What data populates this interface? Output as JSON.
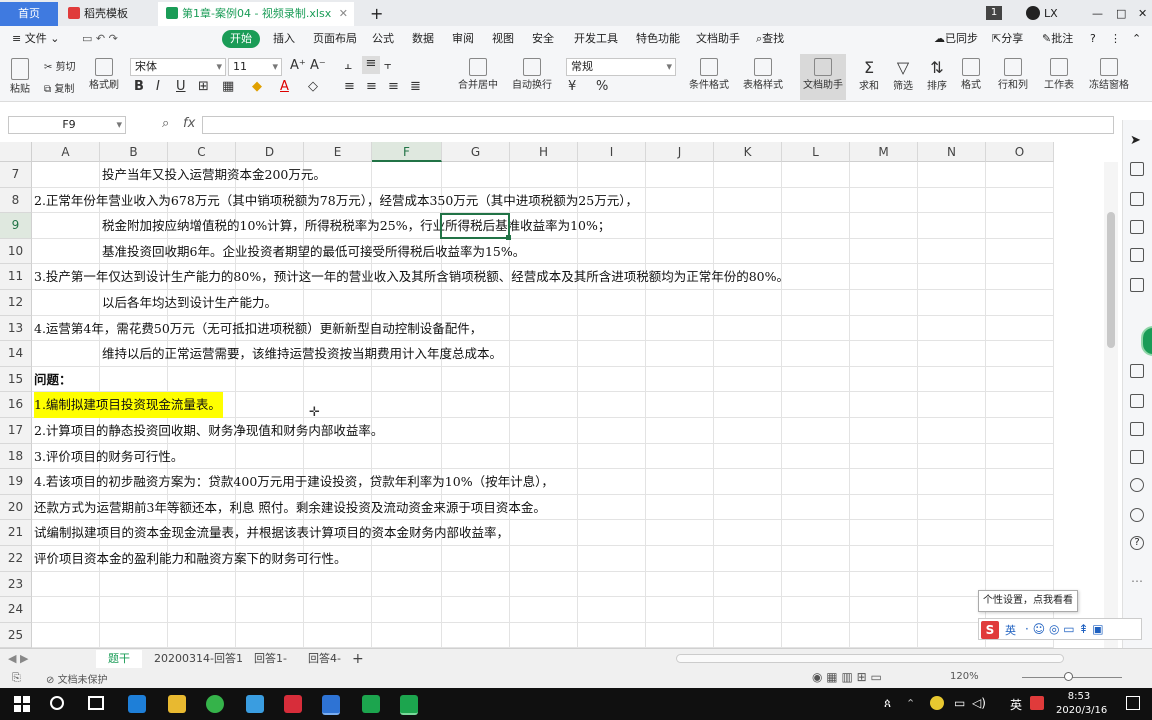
{
  "titlebar": {
    "tabs": [
      {
        "label": "首页",
        "active": false
      },
      {
        "label": "稻壳模板",
        "active": false
      },
      {
        "label": "第1章-案例04 - 视频录制.xlsx",
        "active": true
      }
    ],
    "new_tab": "+",
    "badge": "1",
    "user": "LX",
    "win_min": "—",
    "win_max": "□",
    "win_close": "✕"
  },
  "menubar": {
    "file": "文件",
    "start": "开始",
    "items": [
      "插入",
      "页面布局",
      "公式",
      "数据",
      "审阅",
      "视图",
      "安全",
      "开发工具",
      "特色功能",
      "文档助手"
    ],
    "find": "查找",
    "sync": "已同步",
    "share": "分享",
    "comment": "批注"
  },
  "ribbon": {
    "paste": "粘贴",
    "cut": "剪切",
    "copy": "复制",
    "format_painter": "格式刷",
    "font_name": "宋体",
    "font_size": "11",
    "bold": "B",
    "italic": "I",
    "underline": "U",
    "merge": "合并居中",
    "wrap": "自动换行",
    "number_format": "常规",
    "percent": "%",
    "conditional": "条件格式",
    "table_style": "表格样式",
    "doc_helper": "文档助手",
    "sum": "求和",
    "filter": "筛选",
    "sort": "排序",
    "format": "格式",
    "rowcol": "行和列",
    "worksheet": "工作表",
    "freeze": "冻结窗格"
  },
  "formula_bar": {
    "name_box": "F9",
    "fx": "fx",
    "content": ""
  },
  "columns": [
    "A",
    "B",
    "C",
    "D",
    "E",
    "F",
    "G",
    "H",
    "I",
    "J",
    "K",
    "L",
    "M",
    "N",
    "O"
  ],
  "rows": [
    {
      "num": "7",
      "col": "B",
      "text": "投产当年又投入运营期资本金200万元。"
    },
    {
      "num": "8",
      "col": "A",
      "text": "2.正常年份年营业收入为678万元（其中销项税额为78万元），经营成本350万元（其中进项税额为25万元），"
    },
    {
      "num": "9",
      "col": "B",
      "text": "税金附加按应纳增值税的10%计算，所得税税率为25%，行业所得税后基准收益率为10%；"
    },
    {
      "num": "10",
      "col": "B",
      "text": "基准投资回收期6年。企业投资者期望的最低可接受所得税后收益率为15%。"
    },
    {
      "num": "11",
      "col": "A",
      "text": "3.投产第一年仅达到设计生产能力的80%，预计这一年的营业收入及其所含销项税额、经营成本及其所含进项税额均为正常年份的80%。"
    },
    {
      "num": "12",
      "col": "B",
      "text": "以后各年均达到设计生产能力。"
    },
    {
      "num": "13",
      "col": "A",
      "text": "4.运营第4年，需花费50万元（无可抵扣进项税额）更新新型自动控制设备配件，"
    },
    {
      "num": "14",
      "col": "B",
      "text": "维持以后的正常运营需要，该维持运营投资按当期费用计入年度总成本。"
    },
    {
      "num": "15",
      "col": "A",
      "text": "问题：",
      "bold": true
    },
    {
      "num": "16",
      "col": "A",
      "text": "1.编制拟建项目投资现金流量表。",
      "highlight": "#ffff00"
    },
    {
      "num": "17",
      "col": "A",
      "text": "2.计算项目的静态投资回收期、财务净现值和财务内部收益率。"
    },
    {
      "num": "18",
      "col": "A",
      "text": "3.评价项目的财务可行性。"
    },
    {
      "num": "19",
      "col": "A",
      "text": "4.若该项目的初步融资方案为：贷款400万元用于建设投资，贷款年利率为10%（按年计息），"
    },
    {
      "num": "20",
      "col": "A",
      "text": "还款方式为运营期前3年等额还本，利息 照付。剩余建设投资及流动资金来源于项目资本金。"
    },
    {
      "num": "21",
      "col": "A",
      "text": "试编制拟建项目的资本金现金流量表，并根据该表计算项目的资本金财务内部收益率，"
    },
    {
      "num": "22",
      "col": "A",
      "text": "评价项目资本金的盈利能力和融资方案下的财务可行性。"
    },
    {
      "num": "23",
      "col": "A",
      "text": ""
    },
    {
      "num": "24",
      "col": "A",
      "text": ""
    },
    {
      "num": "25",
      "col": "A",
      "text": ""
    }
  ],
  "tooltip": "个性设置，点我看看",
  "ime": "英",
  "sheet_tabs": [
    "题干",
    "20200314-回答1",
    "回答1-",
    "回答4-"
  ],
  "sheet_add": "+",
  "status": {
    "protect": "文档未保护",
    "zoom": "120%"
  },
  "taskbar": {
    "time": "8:53",
    "date": "2020/3/16",
    "lang": "英"
  },
  "colors": {
    "accent_green": "#1a9c57",
    "highlight": "#ffff00",
    "selection": "#217346"
  }
}
